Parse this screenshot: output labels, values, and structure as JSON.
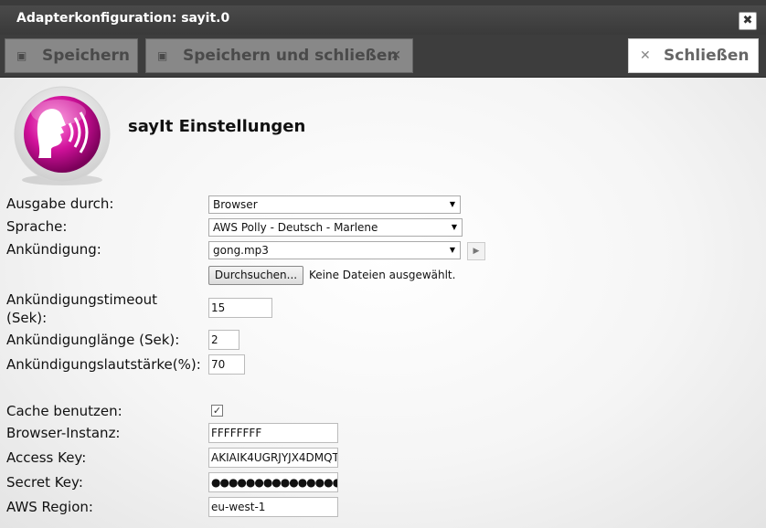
{
  "window": {
    "title": "Adapterkonfiguration: sayit.0",
    "close_glyph": "✖"
  },
  "toolbar": {
    "save_label": "Speichern",
    "save_close_label": "Speichern und schließen",
    "close_label": "Schließen"
  },
  "header": {
    "title": "sayIt Einstellungen"
  },
  "form": {
    "output": {
      "label": "Ausgabe durch:",
      "value": "Browser"
    },
    "language": {
      "label": "Sprache:",
      "value": "AWS Polly - Deutsch - Marlene"
    },
    "announce": {
      "label": "Ankündigung:",
      "value": "gong.mp3"
    },
    "file": {
      "button_label": "Durchsuchen...",
      "status": "Keine Dateien ausgewählt."
    },
    "announce_timeout": {
      "label_line1": "Ankündigungstimeout",
      "label_line2": "(Sek):",
      "value": "15"
    },
    "announce_length": {
      "label": "Ankündigunglänge (Sek):",
      "value": "2"
    },
    "announce_volume": {
      "label": "Ankündigungslautstärke(%):",
      "value": "70"
    },
    "cache": {
      "label": "Cache benutzen:",
      "checked": true
    },
    "browser_instance": {
      "label": "Browser-Instanz:",
      "value": "FFFFFFFF"
    },
    "access_key": {
      "label": "Access Key:",
      "value": "AKIAIK4UGRJYJX4DMQT"
    },
    "secret_key": {
      "label": "Secret Key:",
      "value": "●●●●●●●●●●●●●●●●●"
    },
    "aws_region": {
      "label": "AWS Region:",
      "value": "eu-west-1"
    }
  },
  "colors": {
    "logo_magenta": "#d0119a",
    "titlebar": "#3d3d3d"
  }
}
